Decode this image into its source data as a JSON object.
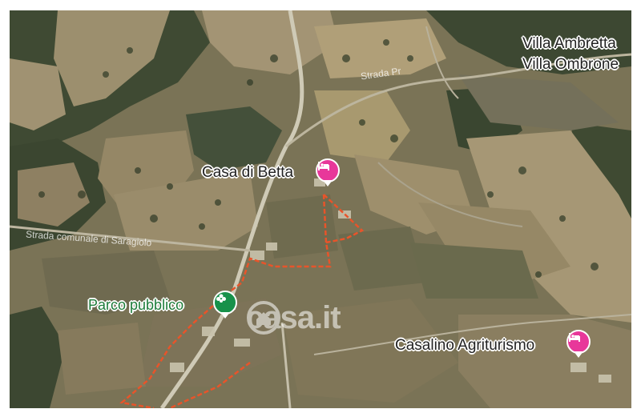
{
  "map": {
    "labels": {
      "villa_ambretta": "Villa Ambretta",
      "villa_ombrone": "Villa Ombrone",
      "casa_di_betta": "Casa di Betta",
      "parco_pubblico": "Parco pubblico",
      "casalino_agriturismo": "Casalino Agriturismo"
    },
    "roads": {
      "strada_top": "Strada Pr",
      "strada_left": "Strada comunale di Saragiolo"
    },
    "pins": {
      "casa_di_betta": "bed-icon",
      "parco_pubblico": "park-icon",
      "casalino_agriturismo": "bed-icon"
    },
    "watermark": "casa.it",
    "colors": {
      "hotel_pin": "#e8379a",
      "park_pin": "#17914a",
      "boundary": "#e8542a"
    }
  }
}
